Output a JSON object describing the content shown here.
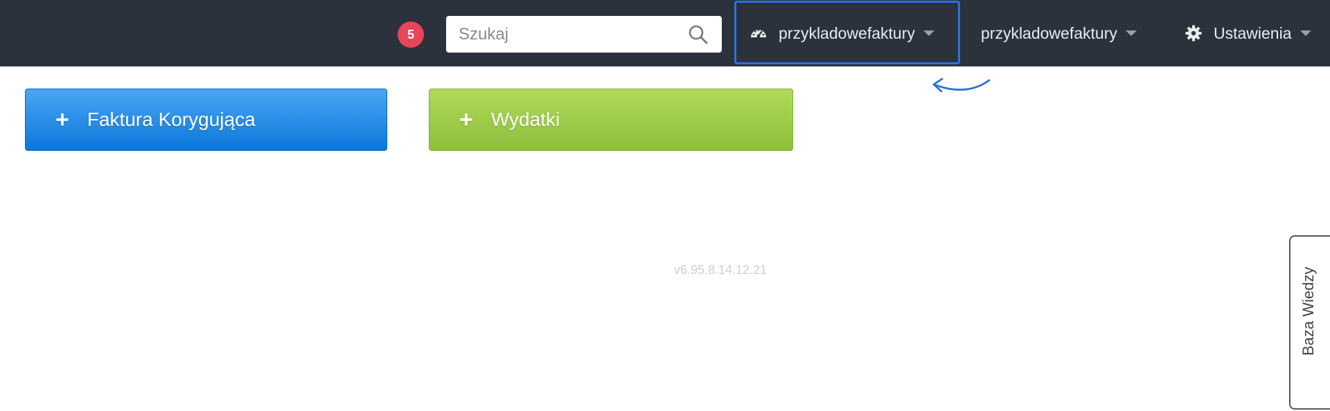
{
  "topbar": {
    "notification_count": "5",
    "search": {
      "placeholder": "Szukaj",
      "icon": "search-icon"
    },
    "company_menu": {
      "label": "przykladowefaktury",
      "icon": "dashboard-icon"
    },
    "account_menu": {
      "label": "przykladowefaktury"
    },
    "settings_menu": {
      "label": "Ustawienia",
      "icon": "gear-icon"
    }
  },
  "actions": {
    "correction_invoice_label": "Faktura Korygująca",
    "expenses_label": "Wydatki"
  },
  "footer": {
    "version": "v6.95.8.14.12.21"
  },
  "knowledge_base_tab": {
    "label": "Baza Wiedzy"
  },
  "colors": {
    "topbar_bg": "#2b323c",
    "badge": "#e84559",
    "highlight": "#2a72e0",
    "blue_button": "#0b77db",
    "green_button": "#8dbf3b"
  }
}
